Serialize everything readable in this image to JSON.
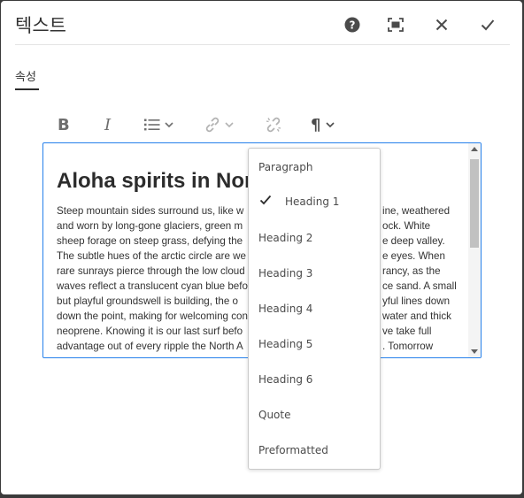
{
  "dialog": {
    "title": "텍스트",
    "tab_label": "속성",
    "header_buttons": [
      "help-icon",
      "fullscreen-icon",
      "close-icon",
      "check-icon"
    ]
  },
  "toolbar": {
    "bold": "B",
    "italic": "I",
    "paragraph": "¶"
  },
  "editor": {
    "heading": "Aloha spirits in North",
    "lines": [
      "Steep mountain sides surround us, like w",
      "and worn by long-gone glaciers, green m",
      "sheep forage on steep grass, defying the",
      "The subtle hues of the arctic circle are we",
      "rare sunrays pierce through the low cloud",
      "waves reflect a translucent cyan blue befo",
      "but playful groundswell is building, the o",
      "down the point, making for welcoming condition",
      "neoprene. Knowing it is our last surf befo",
      "advantage out of every ripple the North A"
    ],
    "lines_right": [
      "ine, weathered",
      "ock. White",
      "e deep valley.",
      "e eyes. When",
      "rancy, as the",
      "ce sand. A small",
      "yful lines down",
      "water and thick",
      "ve take full",
      ". Tomorrow"
    ]
  },
  "format_menu": {
    "items": [
      "Paragraph",
      "Heading 1",
      "Heading 2",
      "Heading 3",
      "Heading 4",
      "Heading 5",
      "Heading 6",
      "Quote",
      "Preformatted"
    ],
    "selected": "Heading 1"
  }
}
